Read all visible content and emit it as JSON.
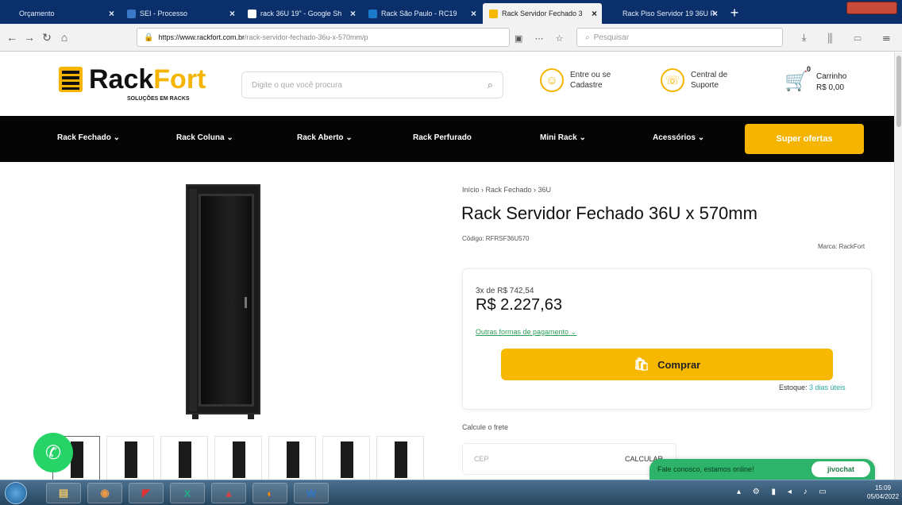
{
  "browser": {
    "tabs": [
      {
        "title": "Orçamento",
        "color": "#0a2f6b",
        "active": false
      },
      {
        "title": "SEI - Processo",
        "color": "#3a79c9",
        "active": false
      },
      {
        "title": "rack 36U 19\" - Google Sh",
        "color": "#ffffff",
        "active": false
      },
      {
        "title": "Rack São Paulo - RC19",
        "color": "#1b7ac9",
        "active": false
      },
      {
        "title": "Rack Servidor Fechado 3",
        "color": "#f6b800",
        "active": true
      },
      {
        "title": "Rack Piso Servidor 19 36U P",
        "color": "#0a2f6b",
        "active": false
      }
    ],
    "url_domain": "https://www.rackfort.com.br",
    "url_path": "/rack-servidor-fechado-36u-x-570mm/p",
    "search_placeholder": "Pesquisar"
  },
  "site": {
    "logo_rack": "Rack",
    "logo_fort": "Fort",
    "logo_tagline": "SOLUÇÕES EM RACKS",
    "search_placeholder": "Digite o que você procura",
    "login_line1": "Entre ou se",
    "login_line2": "Cadastre",
    "support_line1": "Central de",
    "support_line2": "Suporte",
    "cart_count": "0",
    "cart_label": "Carrinho",
    "cart_total": "R$ 0,00"
  },
  "menu": {
    "items": [
      "Rack Fechado ⌄",
      "Rack Coluna ⌄",
      "Rack Aberto ⌄",
      "Rack Perfurado",
      "Mini Rack ⌄",
      "Acessórios ⌄"
    ],
    "offers": "Super ofertas"
  },
  "product": {
    "breadcrumb": "Início › Rack Fechado › 36U",
    "title": "Rack Servidor Fechado 36U x 570mm",
    "code": "Código: RFRSF36U570",
    "brand": "Marca: RackFort",
    "installments": "3x de R$ 742,54",
    "price": "R$ 2.227,63",
    "payment_options": "Outras formas de pagamento ⌄",
    "buy_label": "Comprar",
    "stock_label": "Estoque:",
    "stock_days": "3 dias úteis",
    "freight_label": "Calcule o frete",
    "cep_placeholder": "CEP",
    "calc_label": "CALCULAR"
  },
  "chat": {
    "message": "Fale conosco, estamos online!",
    "brand": "jivochat"
  },
  "taskbar": {
    "time": "15:09",
    "date": "05/04/2022"
  }
}
